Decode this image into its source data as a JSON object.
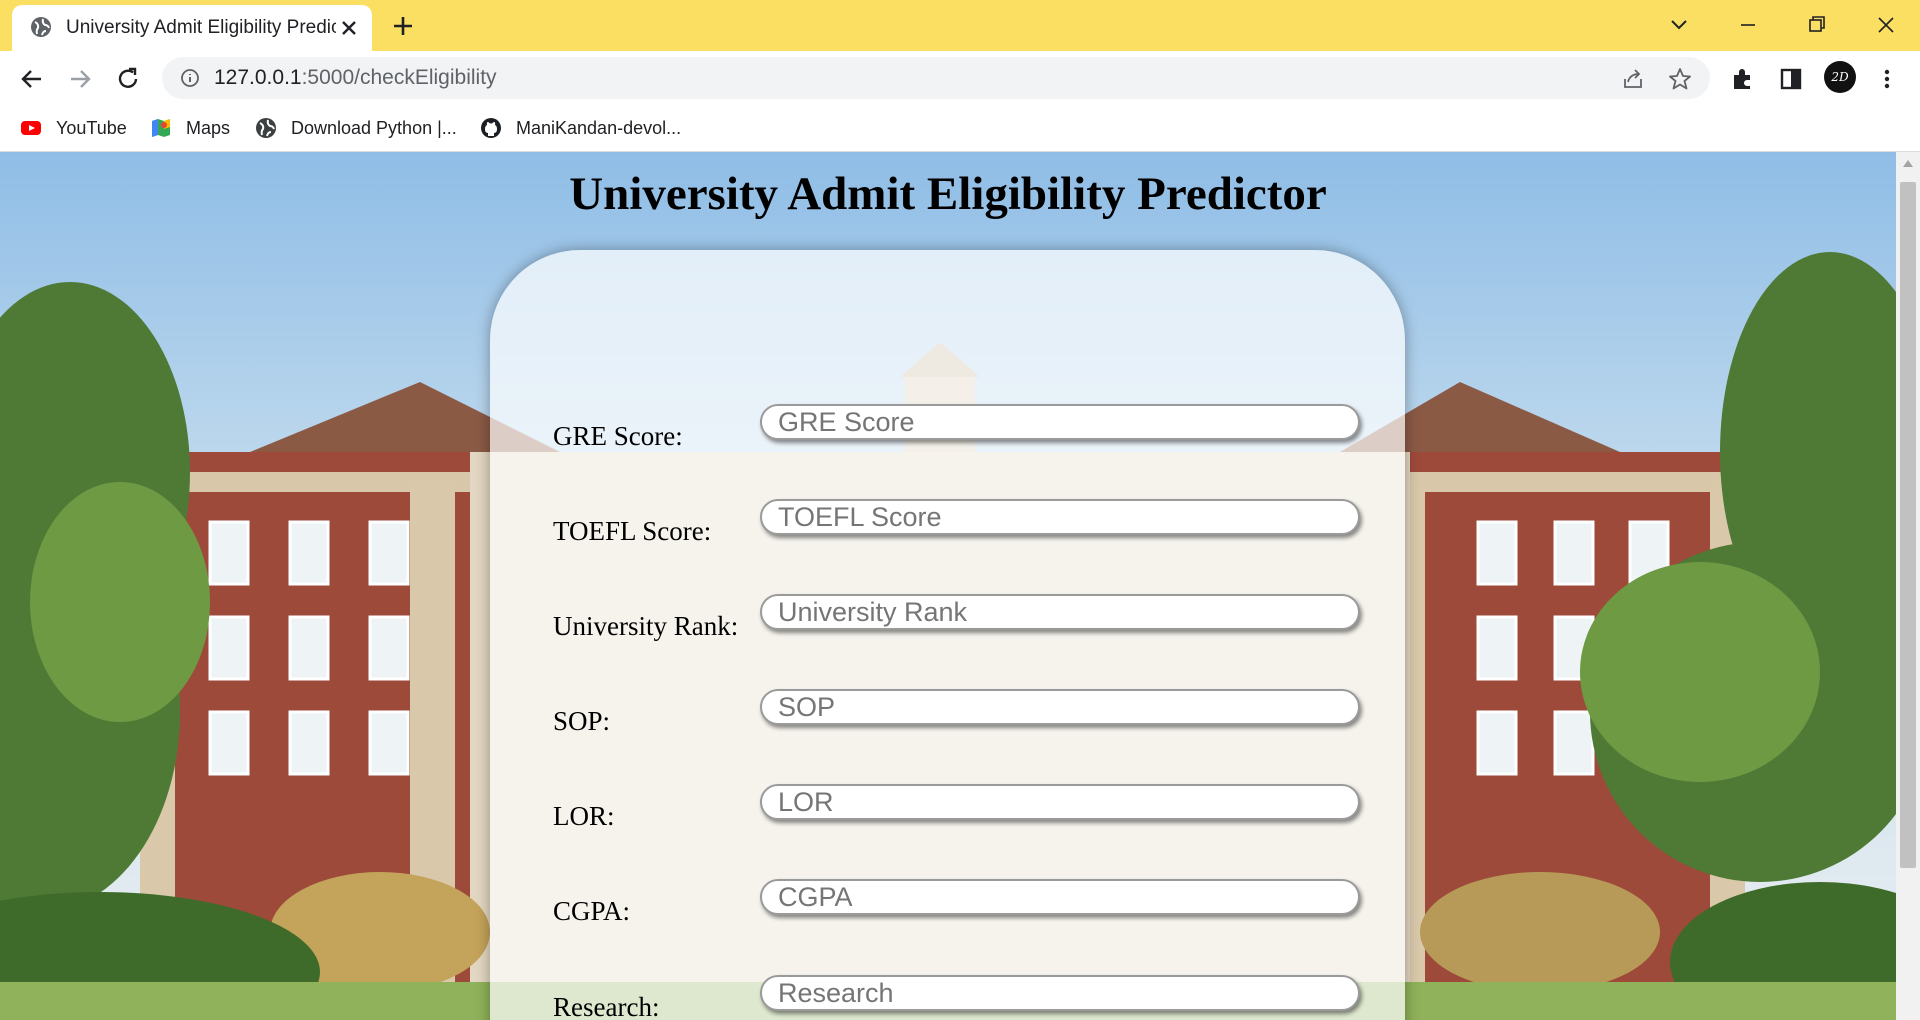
{
  "browser": {
    "tab_title": "University Admit Eligibility Predictor",
    "url_host": "127.0.0.1",
    "url_path": ":5000/checkEligibility",
    "bookmarks": [
      {
        "label": "YouTube",
        "icon": "youtube-icon"
      },
      {
        "label": "Maps",
        "icon": "maps-icon"
      },
      {
        "label": "Download Python |...",
        "icon": "globe-icon"
      },
      {
        "label": "ManiKandan-devol...",
        "icon": "github-icon"
      }
    ],
    "profile_initials": "2D"
  },
  "page": {
    "title": "University Admit Eligibility Predictor",
    "fields": [
      {
        "label": "GRE Score:",
        "placeholder": "GRE Score"
      },
      {
        "label": "TOEFL Score:",
        "placeholder": "TOEFL Score"
      },
      {
        "label": "University Rank:",
        "placeholder": "University Rank"
      },
      {
        "label": "SOP:",
        "placeholder": "SOP"
      },
      {
        "label": "LOR:",
        "placeholder": "LOR"
      },
      {
        "label": "CGPA:",
        "placeholder": "CGPA"
      },
      {
        "label": "Research:",
        "placeholder": "Research"
      }
    ]
  },
  "colors": {
    "tab_strip": "#fbdf62",
    "card": "rgba(255,255,255,0.70)"
  }
}
